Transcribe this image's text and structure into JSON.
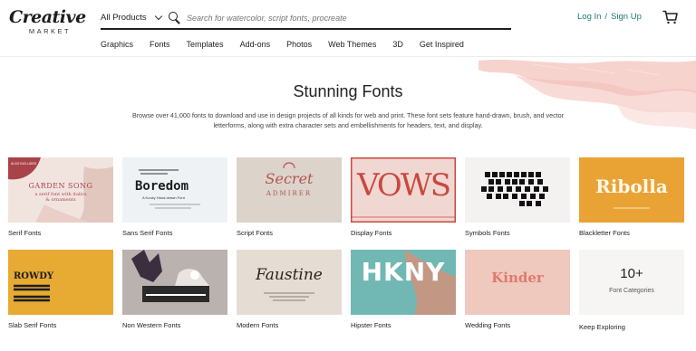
{
  "brand": {
    "logo_main": "Creative",
    "logo_sub": "MARKET"
  },
  "search": {
    "category": "All Products",
    "placeholder": "Search for watercolor, script fonts, procreate"
  },
  "auth": {
    "login": "Log In",
    "separator": "/",
    "signup": "Sign Up"
  },
  "nav": [
    "Graphics",
    "Fonts",
    "Templates",
    "Add-ons",
    "Photos",
    "Web Themes",
    "3D",
    "Get Inspired"
  ],
  "hero": {
    "title": "Stunning Fonts",
    "description": "Browse over 41,000 fonts to download and use in design projects of all kinds for web and print. These font sets feature hand-drawn, brush, and vector letterforms, along with extra character sets and embellishments for headers, text, and display."
  },
  "categories": [
    {
      "label": "Serif Fonts",
      "thumb_text": "GARDEN SONG",
      "thumb_sub": "a serif font with italics & ornaments",
      "badge": "ALSO INCLUDED"
    },
    {
      "label": "Sans Serif Fonts",
      "thumb_text": "Boredom",
      "thumb_sub": "A Kooky Hand-drawn Font"
    },
    {
      "label": "Script Fonts",
      "thumb_text": "Secret",
      "thumb_sub": "ADMIRER"
    },
    {
      "label": "Display Fonts",
      "thumb_text": "VOWS"
    },
    {
      "label": "Symbols Fonts",
      "thumb_text": ""
    },
    {
      "label": "Blackletter Fonts",
      "thumb_text": "Ribolla"
    },
    {
      "label": "Slab Serif Fonts",
      "thumb_text": "ROWDY"
    },
    {
      "label": "Non Western Fonts",
      "thumb_text": ""
    },
    {
      "label": "Modern Fonts",
      "thumb_text": "Faustine"
    },
    {
      "label": "Hipster Fonts",
      "thumb_text": "HKNY"
    },
    {
      "label": "Wedding Fonts",
      "thumb_text": "Kinder"
    },
    {
      "label": "Keep Exploring",
      "thumb_text": "10+",
      "thumb_sub": "Font Categories"
    }
  ],
  "colors": {
    "accent_green": "#1e7a6b",
    "brush_pink": "#f6c9c4"
  }
}
